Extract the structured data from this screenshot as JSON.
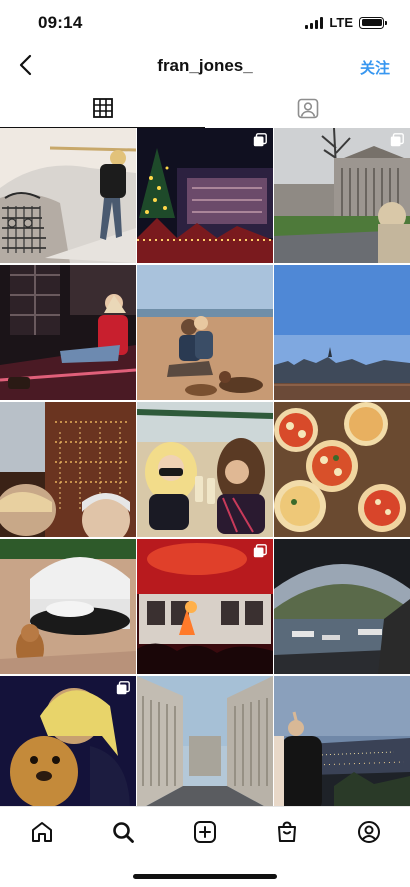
{
  "status": {
    "time": "09:14",
    "network": "LTE"
  },
  "nav": {
    "title": "fran_jones_",
    "follow": "关注"
  },
  "tabs": [
    {
      "name": "grid",
      "icon": "grid-icon"
    },
    {
      "name": "tagged",
      "icon": "tagged-person-icon"
    }
  ],
  "posts": [
    {
      "label": "staircase-railing",
      "multiple": false
    },
    {
      "label": "christmas-market-night",
      "multiple": true
    },
    {
      "label": "museum-building",
      "multiple": true
    },
    {
      "label": "girl-sitting-ferris-wheel",
      "multiple": false
    },
    {
      "label": "beach-couple-dogs",
      "multiple": false
    },
    {
      "label": "city-panorama",
      "multiple": false
    },
    {
      "label": "harrods-selfie",
      "multiple": false
    },
    {
      "label": "friends-champagne",
      "multiple": false
    },
    {
      "label": "pizzas-table",
      "multiple": false
    },
    {
      "label": "daybed-dog",
      "multiple": false
    },
    {
      "label": "concert-stage",
      "multiple": true
    },
    {
      "label": "harbour-arch",
      "multiple": false
    },
    {
      "label": "selfie-dog",
      "multiple": true
    },
    {
      "label": "street-buildings",
      "multiple": false
    },
    {
      "label": "city-overlook-dusk",
      "multiple": false
    }
  ],
  "bottom_nav": [
    {
      "name": "home",
      "icon": "home-icon"
    },
    {
      "name": "search",
      "icon": "search-icon"
    },
    {
      "name": "new-post",
      "icon": "add-post-icon"
    },
    {
      "name": "shop",
      "icon": "shop-bag-icon"
    },
    {
      "name": "profile",
      "icon": "profile-icon"
    }
  ]
}
